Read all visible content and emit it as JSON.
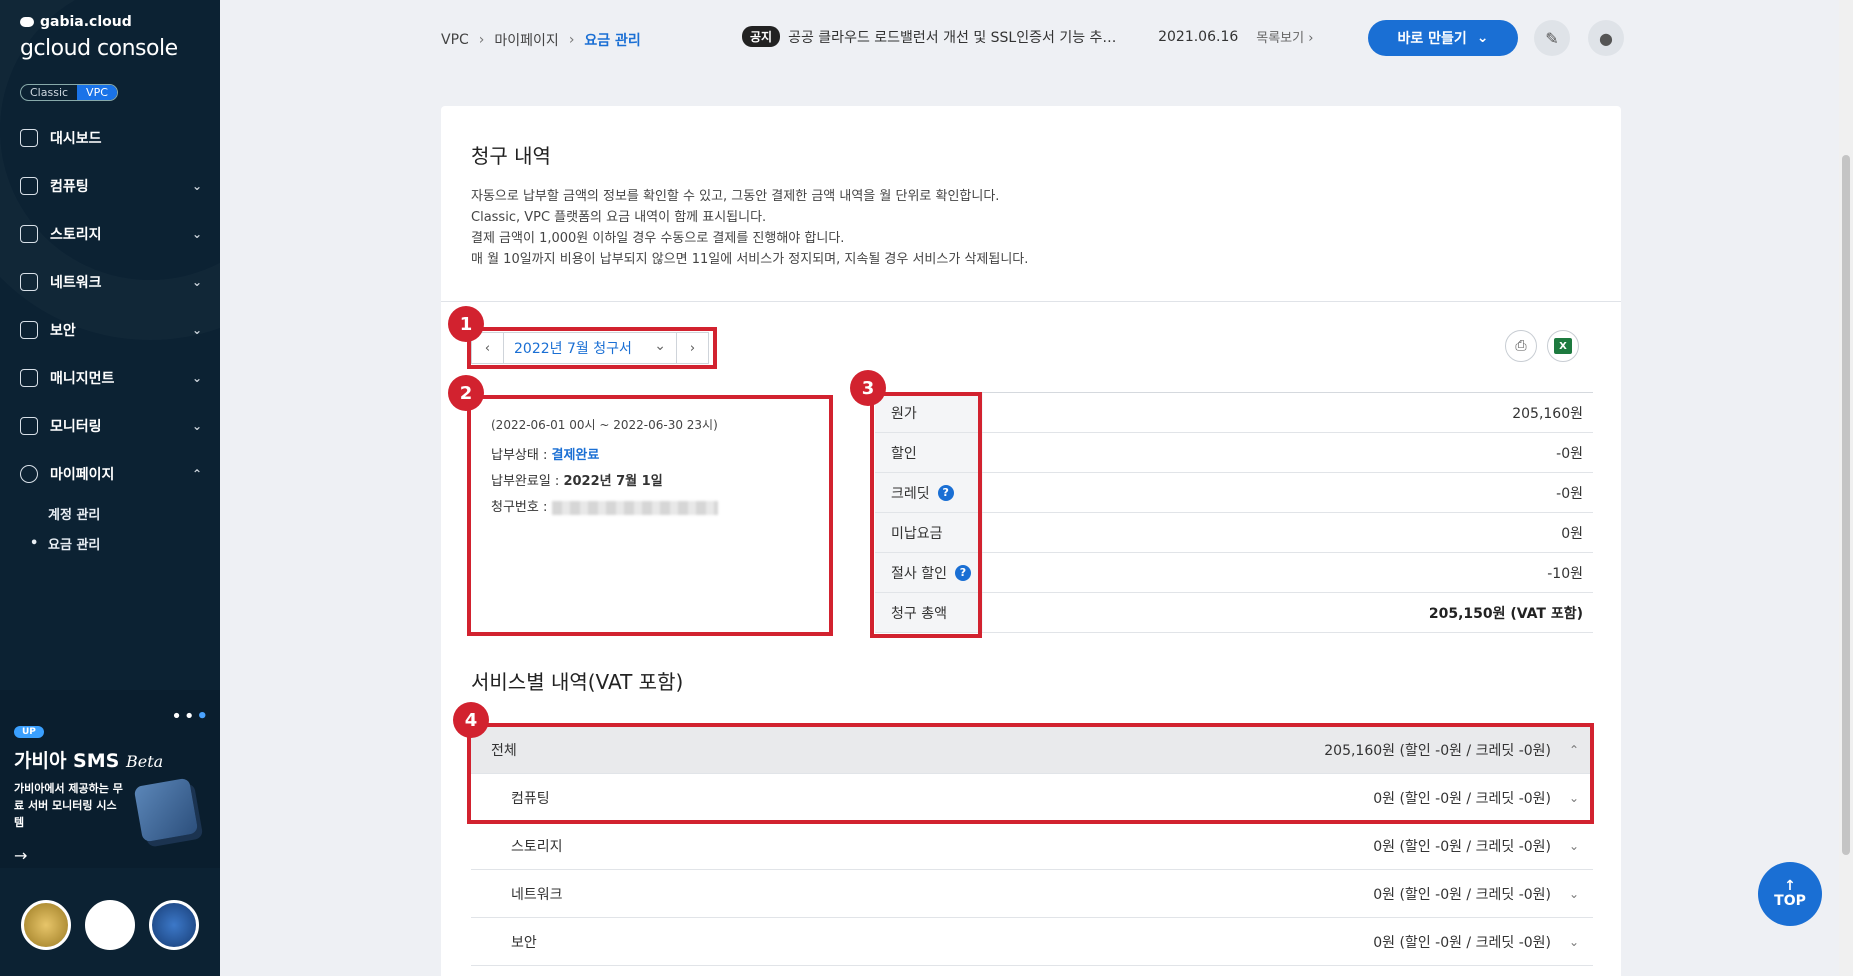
{
  "sidebar": {
    "brand_top": "gabia.cloud",
    "brand_main": "gcloud console",
    "platform_classic": "Classic",
    "platform_vpc": "VPC",
    "items": [
      {
        "label": "대시보드",
        "icon": "dashboard-icon"
      },
      {
        "label": "컴퓨팅",
        "icon": "chip-icon"
      },
      {
        "label": "스토리지",
        "icon": "storage-icon"
      },
      {
        "label": "네트워크",
        "icon": "network-icon"
      },
      {
        "label": "보안",
        "icon": "shield-icon"
      },
      {
        "label": "매니지먼트",
        "icon": "management-icon"
      },
      {
        "label": "모니터링",
        "icon": "monitor-icon"
      },
      {
        "label": "마이페이지",
        "icon": "user-icon"
      }
    ],
    "subitems": [
      "계정 관리",
      "요금 관리"
    ],
    "promo": {
      "up": "UP",
      "title": "가비아 SMS",
      "title_suffix": "Beta",
      "desc": "가비아에서 제공하는 무료 서버 모니터링 시스템",
      "arrow": "→"
    }
  },
  "topbar": {
    "crumbs": [
      "VPC",
      "마이페이지",
      "요금 관리"
    ],
    "crumb_sep": "›",
    "notice_tag": "공지",
    "notice_text": "공공 클라우드 로드밸런서 개선 및 SSL인증서 기능 추…",
    "notice_date": "2021.06.16",
    "notice_more": "목록보기 ›",
    "create_label": "바로 만들기"
  },
  "billing": {
    "title": "청구 내역",
    "desc": [
      "자동으로 납부할 금액의 정보를 확인할 수 있고, 그동안 결제한 금액 내역을 월 단위로 확인합니다.",
      "Classic, VPC 플랫폼의 요금 내역이 함께 표시됩니다.",
      "결제 금액이 1,000원 이하일 경우 수동으로 결제를 진행해야 합니다.",
      "매 월 10일까지 비용이 납부되지 않으면 11일에 서비스가 정지되며, 지속될 경우 서비스가 삭제됩니다."
    ],
    "month": "2022년 7월 청구서",
    "period": "(2022-06-01 00시 ~ 2022-06-30 23시)",
    "status_label": "납부상태 : ",
    "status_value": "결제완료",
    "paid_label": "납부완료일 : ",
    "paid_value": "2022년 7월 1일",
    "invoice_label": "청구번호 : ",
    "summary": [
      {
        "label": "원가",
        "value": "205,160원"
      },
      {
        "label": "할인",
        "value": "-0원"
      },
      {
        "label": "크레딧",
        "value": "-0원",
        "help": "?"
      },
      {
        "label": "미납요금",
        "value": "0원"
      },
      {
        "label": "절사 할인",
        "value": "-10원",
        "help": "?"
      },
      {
        "label": "청구 총액",
        "value": "205,150원 (VAT 포함)"
      }
    ]
  },
  "services": {
    "title": "서비스별 내역(VAT 포함)",
    "rows": [
      {
        "name": "전체",
        "value": "205,160원 (할인 -0원 / 크레딧 -0원)",
        "chevron": "^"
      },
      {
        "name": "컴퓨팅",
        "value": "0원 (할인 -0원 / 크레딧 -0원)",
        "chevron": "v"
      },
      {
        "name": "스토리지",
        "value": "0원 (할인 -0원 / 크레딧 -0원)",
        "chevron": "v"
      },
      {
        "name": "네트워크",
        "value": "0원 (할인 -0원 / 크레딧 -0원)",
        "chevron": "v"
      },
      {
        "name": "보안",
        "value": "0원 (할인 -0원 / 크레딧 -0원)",
        "chevron": "v"
      }
    ]
  },
  "annotations": [
    "1",
    "2",
    "3",
    "4"
  ],
  "top_button": "TOP",
  "colors": {
    "accent": "#1a6fd4",
    "annotation": "#d2222f",
    "sidebar": "#0c2233"
  }
}
